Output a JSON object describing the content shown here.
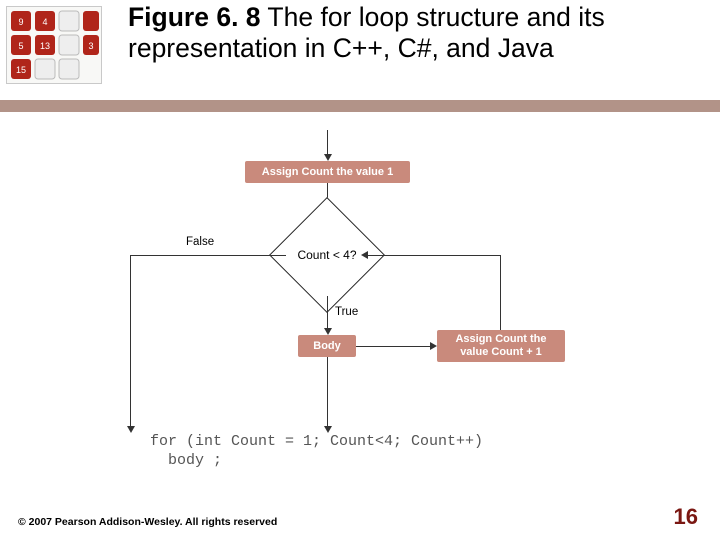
{
  "title_strong": "Figure 6. 8",
  "title_rest": "  The for loop structure and its representation in C++, C#, and Java",
  "flow": {
    "assign1": "Assign Count the value 1",
    "condition": "Count < 4?",
    "false_label": "False",
    "true_label": "True",
    "body": "Body",
    "assign2_l1": "Assign Count the",
    "assign2_l2": "value Count + 1"
  },
  "code_line1": "for (int Count = 1; Count<4; Count++)",
  "code_line2": "  body ;",
  "footer": "© 2007 Pearson Addison-Wesley. All rights reserved",
  "page": "16",
  "chart_data": {
    "type": "flowchart",
    "nodes": [
      {
        "id": "n1",
        "kind": "process",
        "text": "Assign Count the value 1"
      },
      {
        "id": "n2",
        "kind": "decision",
        "text": "Count < 4?"
      },
      {
        "id": "n3",
        "kind": "process",
        "text": "Body"
      },
      {
        "id": "n4",
        "kind": "process",
        "text": "Assign Count the value Count + 1"
      }
    ],
    "edges": [
      {
        "from": "start",
        "to": "n1"
      },
      {
        "from": "n1",
        "to": "n2"
      },
      {
        "from": "n2",
        "to": "n3",
        "label": "True"
      },
      {
        "from": "n2",
        "to": "exit",
        "label": "False"
      },
      {
        "from": "n3",
        "to": "n4"
      },
      {
        "from": "n4",
        "to": "n2"
      }
    ],
    "code_equivalent": "for (int Count = 1; Count<4; Count++) body ;",
    "languages": [
      "C++",
      "C#",
      "Java"
    ]
  }
}
